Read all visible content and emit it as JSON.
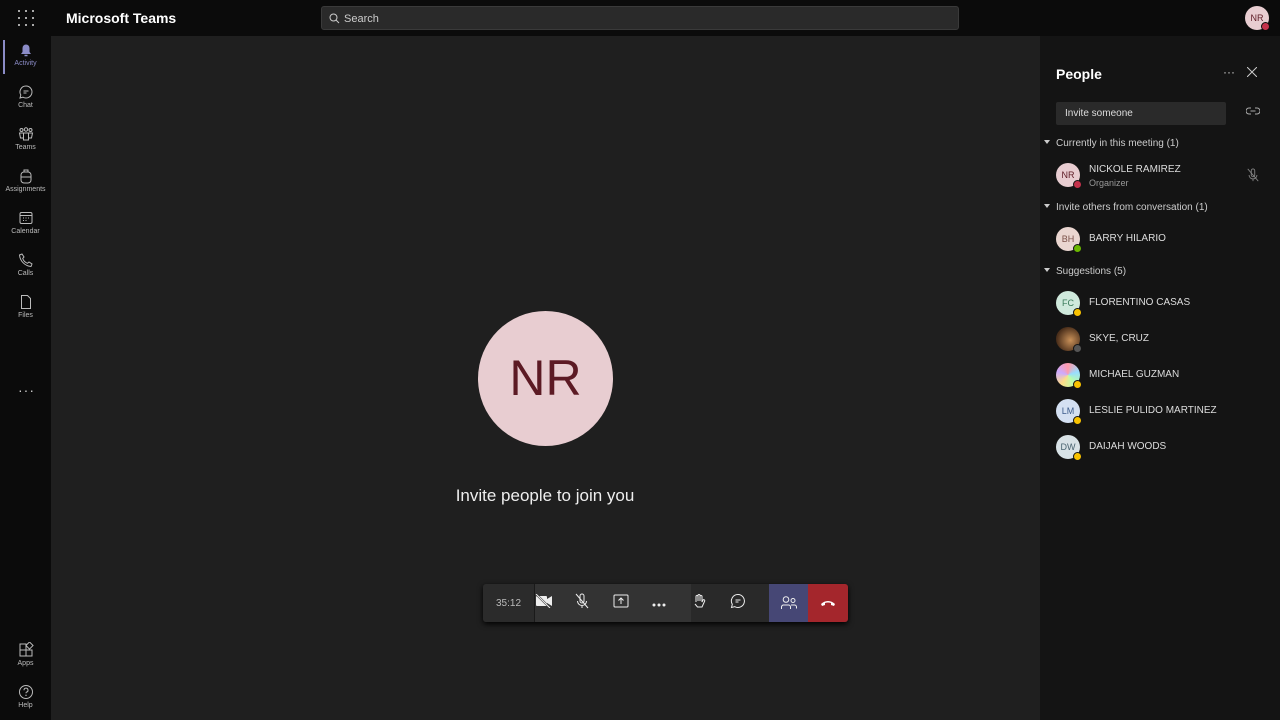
{
  "app": {
    "title": "Microsoft Teams",
    "search_placeholder": "Search",
    "user_initials": "NR"
  },
  "rail": [
    {
      "label": "Activity",
      "icon": "bell-icon",
      "active": true
    },
    {
      "label": "Chat",
      "icon": "chat-icon"
    },
    {
      "label": "Teams",
      "icon": "teams-icon"
    },
    {
      "label": "Assignments",
      "icon": "backpack-icon"
    },
    {
      "label": "Calendar",
      "icon": "calendar-icon"
    },
    {
      "label": "Calls",
      "icon": "phone-icon"
    },
    {
      "label": "Files",
      "icon": "file-icon"
    }
  ],
  "rail_more": "···",
  "rail_bottom": [
    {
      "label": "Apps",
      "icon": "apps-icon"
    },
    {
      "label": "Help",
      "icon": "help-icon"
    }
  ],
  "stage": {
    "initials": "NR",
    "message": "Invite people to join you"
  },
  "toolbar": {
    "timer": "35:12"
  },
  "people": {
    "title": "People",
    "more": "···",
    "invite_placeholder": "Invite someone",
    "sections": [
      {
        "label": "Currently in this meeting (1)",
        "members": [
          {
            "initials": "NR",
            "name": "NICKOLE RAMIREZ",
            "role": "Organizer",
            "status": "busy"
          }
        ]
      },
      {
        "label": "Invite others from conversation (1)",
        "members": [
          {
            "initials": "BH",
            "name": "BARRY HILARIO",
            "status": "available"
          }
        ]
      },
      {
        "label": "Suggestions (5)",
        "members": [
          {
            "initials": "FC",
            "name": "FLORENTINO CASAS",
            "status": "away"
          },
          {
            "initials": "",
            "name": "SKYE, CRUZ",
            "status": "offline"
          },
          {
            "initials": "",
            "name": "MICHAEL GUZMAN",
            "status": "away"
          },
          {
            "initials": "LM",
            "name": "LESLIE PULIDO MARTINEZ",
            "status": "away"
          },
          {
            "initials": "DW",
            "name": "DAIJAH WOODS",
            "status": "away"
          }
        ]
      }
    ]
  },
  "colors": {
    "accent": "#8b8cc7",
    "busy": "#c4314b",
    "available": "#6bb700",
    "away": "#f8c200",
    "hangup": "#a4262c"
  }
}
